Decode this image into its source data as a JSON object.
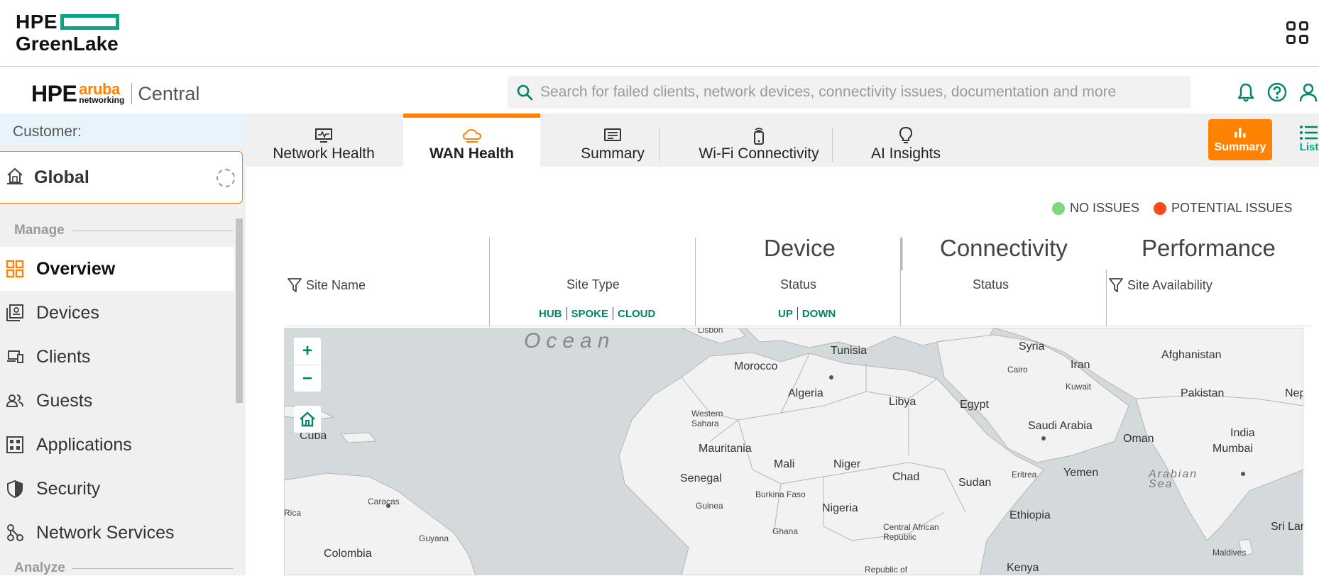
{
  "greenlake": {
    "brand_line1": "HPE",
    "brand_line2": "GreenLake",
    "apps_icon": "apps-grid-icon"
  },
  "header": {
    "brand_hpe": "HPE",
    "brand_aruba": "aruba",
    "brand_networking": "networking",
    "brand_product": "Central",
    "search_placeholder": "Search for failed clients, network devices, connectivity issues, documentation and more",
    "icons": [
      "bell-icon",
      "help-icon",
      "user-icon"
    ]
  },
  "sidebar": {
    "customer_label": "Customer:",
    "scope_label": "Global",
    "manage_header": "Manage",
    "analyze_header": "Analyze",
    "items": [
      {
        "label": "Overview",
        "icon": "overview-grid-icon",
        "active": true
      },
      {
        "label": "Devices",
        "icon": "devices-icon"
      },
      {
        "label": "Clients",
        "icon": "clients-icon"
      },
      {
        "label": "Guests",
        "icon": "guests-icon"
      },
      {
        "label": "Applications",
        "icon": "applications-icon"
      },
      {
        "label": "Security",
        "icon": "shield-icon"
      },
      {
        "label": "Network Services",
        "icon": "network-services-icon"
      }
    ]
  },
  "tabs": [
    {
      "label": "Network Health",
      "icon": "monitor-pulse-icon"
    },
    {
      "label": "WAN Health",
      "icon": "cloud-icon",
      "active": true
    },
    {
      "label": "Summary",
      "icon": "summary-list-icon"
    },
    {
      "label": "Wi-Fi Connectivity",
      "icon": "wifi-phone-icon"
    },
    {
      "label": "AI Insights",
      "icon": "lightbulb-icon"
    }
  ],
  "view_toggle": {
    "summary_label": "Summary",
    "list_label": "List"
  },
  "legend": {
    "no_issues": "NO ISSUES",
    "potential_issues": "POTENTIAL ISSUES",
    "colors": {
      "no_issues": "#7dd87b",
      "potential_issues": "#fc4a1a"
    }
  },
  "grid": {
    "groups": {
      "device": "Device",
      "connectivity": "Connectivity",
      "performance": "Performance"
    },
    "columns": {
      "site_name": "Site Name",
      "site_type": "Site Type",
      "device_status": "Status",
      "connectivity_status": "Status",
      "site_availability": "Site Availability"
    },
    "site_type_filters": {
      "hub": "HUB",
      "spoke": "SPOKE",
      "cloud": "CLOUD"
    },
    "status_filters": {
      "up": "UP",
      "down": "DOWN"
    }
  },
  "map": {
    "zoom_in": "+",
    "zoom_out": "−",
    "ocean_label": "Ocean",
    "labels": {
      "lisbon": "Lisbon",
      "tunisia": "Tunisia",
      "syria": "Syria",
      "iran": "Iran",
      "afghanistan": "Afghanistan",
      "morocco": "Morocco",
      "cairo": "Cairo",
      "kuwait": "Kuwait",
      "pakistan": "Pakistan",
      "nepal": "Nep",
      "algeria": "Algeria",
      "libya": "Libya",
      "egypt": "Egypt",
      "western_sahara": "Western\nSahara",
      "saudi_arabia": "Saudi Arabia",
      "oman": "Oman",
      "india": "India",
      "cuba": "Cuba",
      "mumbai": "Mumbai",
      "mauritania": "Mauritania",
      "mali": "Mali",
      "niger": "Niger",
      "chad": "Chad",
      "sudan": "Sudan",
      "eritrea": "Eritrea",
      "yemen": "Yemen",
      "arabian_sea": "Arabian\nSea",
      "senegal": "Senegal",
      "burkina_faso": "Burkina Faso",
      "guinea": "Guinea",
      "nigeria": "Nigeria",
      "costa_rica": "Rica",
      "caracas": "Caracas",
      "ghana": "Ghana",
      "ethiopia": "Ethiopia",
      "car": "Central African\nRepublic",
      "sri_lanka": "Sri Lank",
      "guyana": "Guyana",
      "colombia": "Colombia",
      "maldives": "Maldives",
      "republic_of": "Republic of",
      "kenya": "Kenya"
    }
  }
}
